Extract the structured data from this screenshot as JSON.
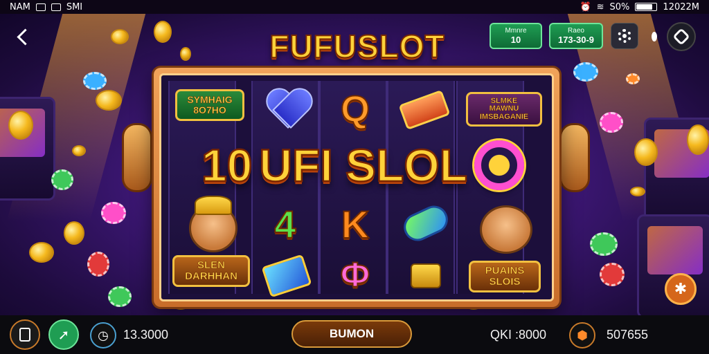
{
  "status_bar": {
    "left_text": "NAM",
    "carrier": "SMI",
    "battery_percent": "S0%",
    "time": "12022M"
  },
  "header": {
    "logo_text": "FUFUSLOT",
    "stat_left": {
      "label": "Mmnre",
      "value": "10"
    },
    "stat_right": {
      "label": "Raeo",
      "value": "173-30-9"
    }
  },
  "reels": {
    "top_left_banner": [
      "SYMHAIG",
      "8O7HO"
    ],
    "top_right_banner": [
      "SLMKE",
      "MAWNU",
      "IMSBAGANIE"
    ],
    "big_banner": {
      "left": "10",
      "middle": "UFI SLOL",
      "right": "O"
    },
    "mid_symbols": [
      "4",
      "K"
    ],
    "bottom_left_label": [
      "SLEN",
      "DARHHAN"
    ],
    "bottom_right_label": [
      "PUAINS",
      "SLOIS"
    ],
    "bottom_pink_symbol": "Ф"
  },
  "bottom_bar": {
    "balance": "13.3000",
    "main_button": "BUMON",
    "win_label": "QKI :8000",
    "total": "507655"
  },
  "colors": {
    "accent_gold": "#ffd23a",
    "frame_orange": "#e08a40",
    "stat_green": "#1f9d53",
    "background_purple": "#3a1670"
  },
  "icons": [
    "back-arrow-icon",
    "gear-icon",
    "profile-hexagon-icon",
    "clipboard-icon",
    "arrow-badge-icon",
    "clock-icon",
    "settings-chip-icon",
    "star-chip-icon"
  ]
}
